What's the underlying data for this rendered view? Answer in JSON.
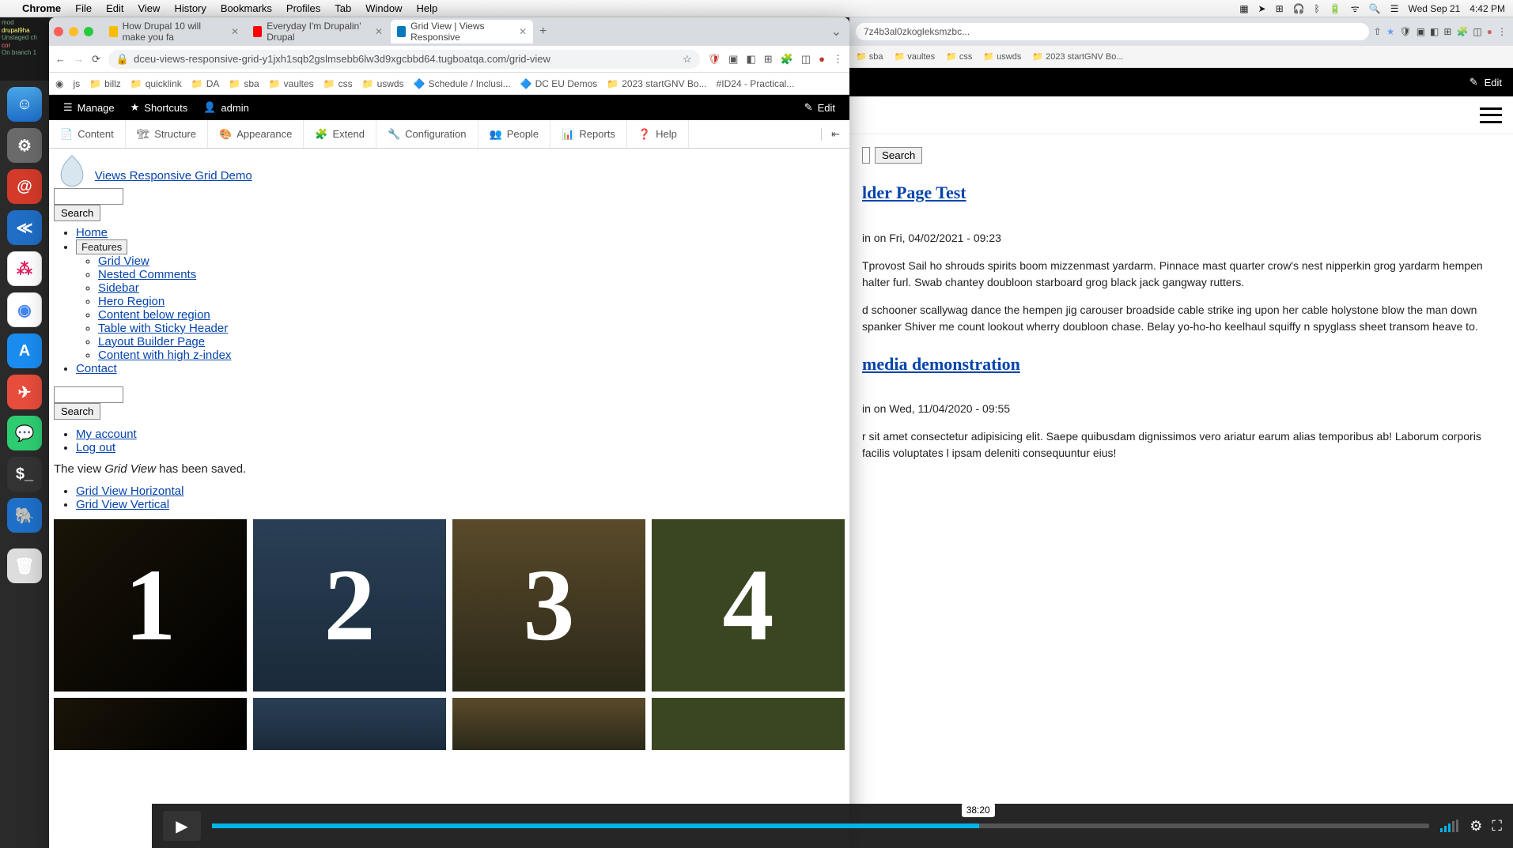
{
  "mac_menu": {
    "app": "Chrome",
    "items": [
      "File",
      "Edit",
      "View",
      "History",
      "Bookmarks",
      "Profiles",
      "Tab",
      "Window",
      "Help"
    ],
    "right": [
      "Wed Sep 21",
      "4:42 PM"
    ]
  },
  "bg_window": {
    "url": "7z4b3al0zkogleksmzbc...",
    "bookmarks": [
      "sba",
      "vaultes",
      "css",
      "uswds",
      "2023 startGNV Bo..."
    ],
    "edit": "Edit",
    "search_btn": "Search",
    "h_link": "lder Page Test",
    "meta1": "in on Fri, 04/02/2021 - 09:23",
    "p1": "Tprovost Sail ho shrouds spirits boom mizzenmast yardarm. Pinnace mast quarter crow's nest nipperkin grog yardarm hempen halter furl. Swab chantey doubloon starboard grog black jack gangway rutters.",
    "p2": "d schooner scallywag dance the hempen jig carouser broadside cable strike ing upon her cable holystone blow the man down spanker Shiver me count lookout wherry doubloon chase. Belay yo-ho-ho keelhaul squiffy n spyglass sheet transom heave to.",
    "h2_link": "media demonstration",
    "meta2": "in on Wed, 11/04/2020 - 09:55",
    "p3": "r sit amet consectetur adipisicing elit. Saepe quibusdam dignissimos vero ariatur earum alias temporibus ab! Laborum corporis facilis voluptates l ipsam deleniti consequuntur eius!"
  },
  "fg_window": {
    "tabs": [
      {
        "label": "How Drupal 10 will make you fa",
        "active": false
      },
      {
        "label": "Everyday I'm Drupalin' Drupal",
        "active": false
      },
      {
        "label": "Grid View | Views Responsive",
        "active": true
      }
    ],
    "url": "dceu-views-responsive-grid-y1jxh1sqb2gslmsebb6lw3d9xgcbbd64.tugboatqa.com/grid-view",
    "bookmarks": [
      "billz",
      "quicklink",
      "DA",
      "sba",
      "vaultes",
      "css",
      "uswds",
      "Schedule / Inclusi...",
      "DC EU Demos",
      "2023 startGNV Bo...",
      "#ID24 - Practical..."
    ],
    "admin": {
      "manage": "Manage",
      "shortcuts": "Shortcuts",
      "admin": "admin",
      "edit": "Edit"
    },
    "toolbar": [
      "Content",
      "Structure",
      "Appearance",
      "Extend",
      "Configuration",
      "People",
      "Reports",
      "Help"
    ],
    "sitename": "Views Responsive Grid Demo",
    "search_btn": "Search",
    "nav": {
      "home": "Home",
      "features": "Features",
      "feature_items": [
        "Grid View",
        "Nested Comments",
        "Sidebar",
        "Hero Region",
        "Content below region",
        "Table with Sticky Header",
        "Layout Builder Page",
        "Content with high z-index"
      ],
      "contact": "Contact"
    },
    "user_menu": [
      "My account",
      "Log out"
    ],
    "save_msg_pre": "The view ",
    "save_msg_em": "Grid View",
    "save_msg_post": " has been saved.",
    "tabs_links": [
      "Grid View Horizontal",
      "Grid View Vertical"
    ],
    "cards": [
      "1",
      "2",
      "3",
      "4"
    ]
  },
  "video": {
    "time": "38:20"
  },
  "terminal": {
    "l1": "mod",
    "l2": "drupal9ha",
    "l3": "Unstaged ch",
    "l4": "cor",
    "l5": "On branch 1"
  }
}
